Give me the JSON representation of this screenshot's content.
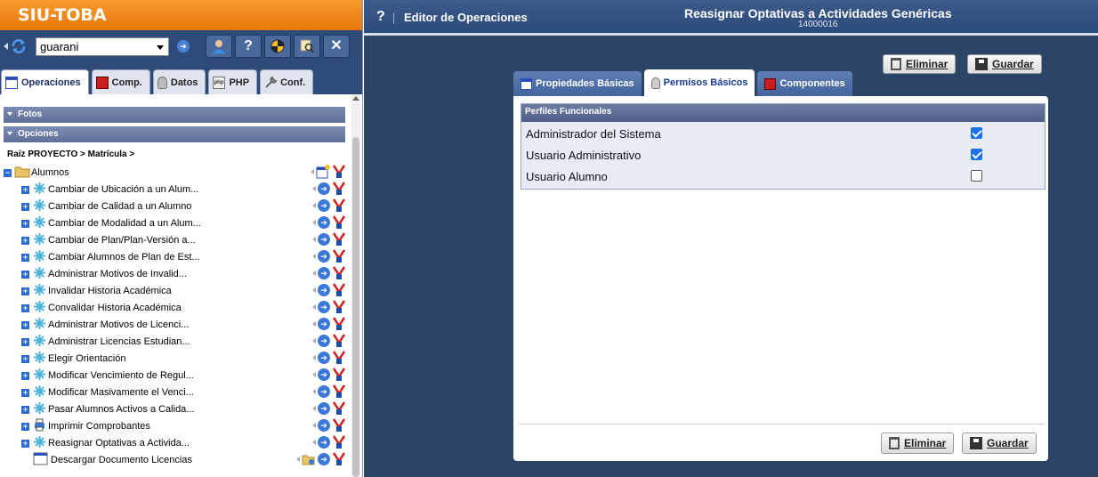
{
  "left": {
    "brand": "SIU-TOBA",
    "project_select": "guarani",
    "tabs": [
      {
        "label": "Operaciones",
        "icon": "operations-icon"
      },
      {
        "label": "Comp.",
        "icon": "components-icon"
      },
      {
        "label": "Datos",
        "icon": "database-icon"
      },
      {
        "label": "PHP",
        "icon": "php-icon"
      },
      {
        "label": "Conf.",
        "icon": "wrench-icon"
      }
    ],
    "sections": [
      "Fotos",
      "Opciones"
    ],
    "breadcrumb": "Raíz PROYECTO > Matrícula >",
    "tree_root": "Alumnos",
    "tree_items": [
      "Cambiar de Ubicación a un Alum...",
      "Cambiar de Calidad a un Alumno",
      "Cambiar de Modalidad a un Alum...",
      "Cambiar de Plan/Plan-Versión a...",
      "Cambiar Alumnos de Plan de Est...",
      "Administrar Motivos de Invalid...",
      "Invalidar Historia Académica",
      "Convalidar Historia Académica",
      "Administrar Motivos de Licenci...",
      "Administrar Licencias Estudian...",
      "Elegir Orientación",
      "Modificar Vencimiento de Regul...",
      "Modificar Masivamente el Venci...",
      "Pasar Alumnos Activos a Calida...",
      "Imprimir Comprobantes",
      "Reasignar Optativas a Activida...",
      "Descargar Documento Licencias"
    ]
  },
  "right": {
    "help": "?",
    "editor_label": "Editor de Operaciones",
    "title": "Reasignar Optativas a Actividades Genéricas",
    "subtitle": "14000016",
    "delete_label": "Eliminar",
    "save_label": "Guardar",
    "tabs": [
      "Propiedades Básicas",
      "Permisos Básicos",
      "Componentes"
    ],
    "profiles_header": "Perfiles Funcionales",
    "profiles": [
      {
        "name": "Administrador del Sistema",
        "checked": true
      },
      {
        "name": "Usuario Administrativo",
        "checked": true
      },
      {
        "name": "Usuario Alumno",
        "checked": false
      }
    ]
  }
}
